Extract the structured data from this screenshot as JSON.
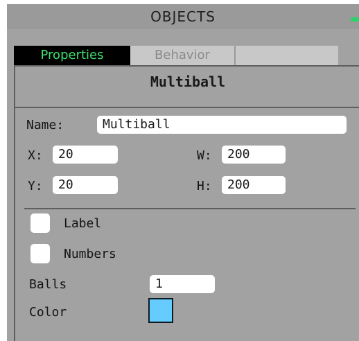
{
  "panel": {
    "title": "OBJECTS",
    "tabs": [
      {
        "label": "Properties",
        "active": true
      },
      {
        "label": "Behavior",
        "active": false
      }
    ],
    "object_name": "Multiball"
  },
  "fields": {
    "name_label": "Name:",
    "name_value": "Multiball",
    "x_label": "X:",
    "x_value": "20",
    "y_label": "Y:",
    "y_value": "20",
    "w_label": "W:",
    "w_value": "200",
    "h_label": "H:",
    "h_value": "200"
  },
  "options": {
    "label_checkbox": {
      "label": "Label",
      "checked": false
    },
    "numbers_checkbox": {
      "label": "Numbers",
      "checked": false
    },
    "balls_label": "Balls",
    "balls_value": "1",
    "color_label": "Color",
    "color_value": "#66ccff"
  },
  "colors": {
    "accent_green": "#3fe06e",
    "panel_bg": "#a2a2a2"
  }
}
